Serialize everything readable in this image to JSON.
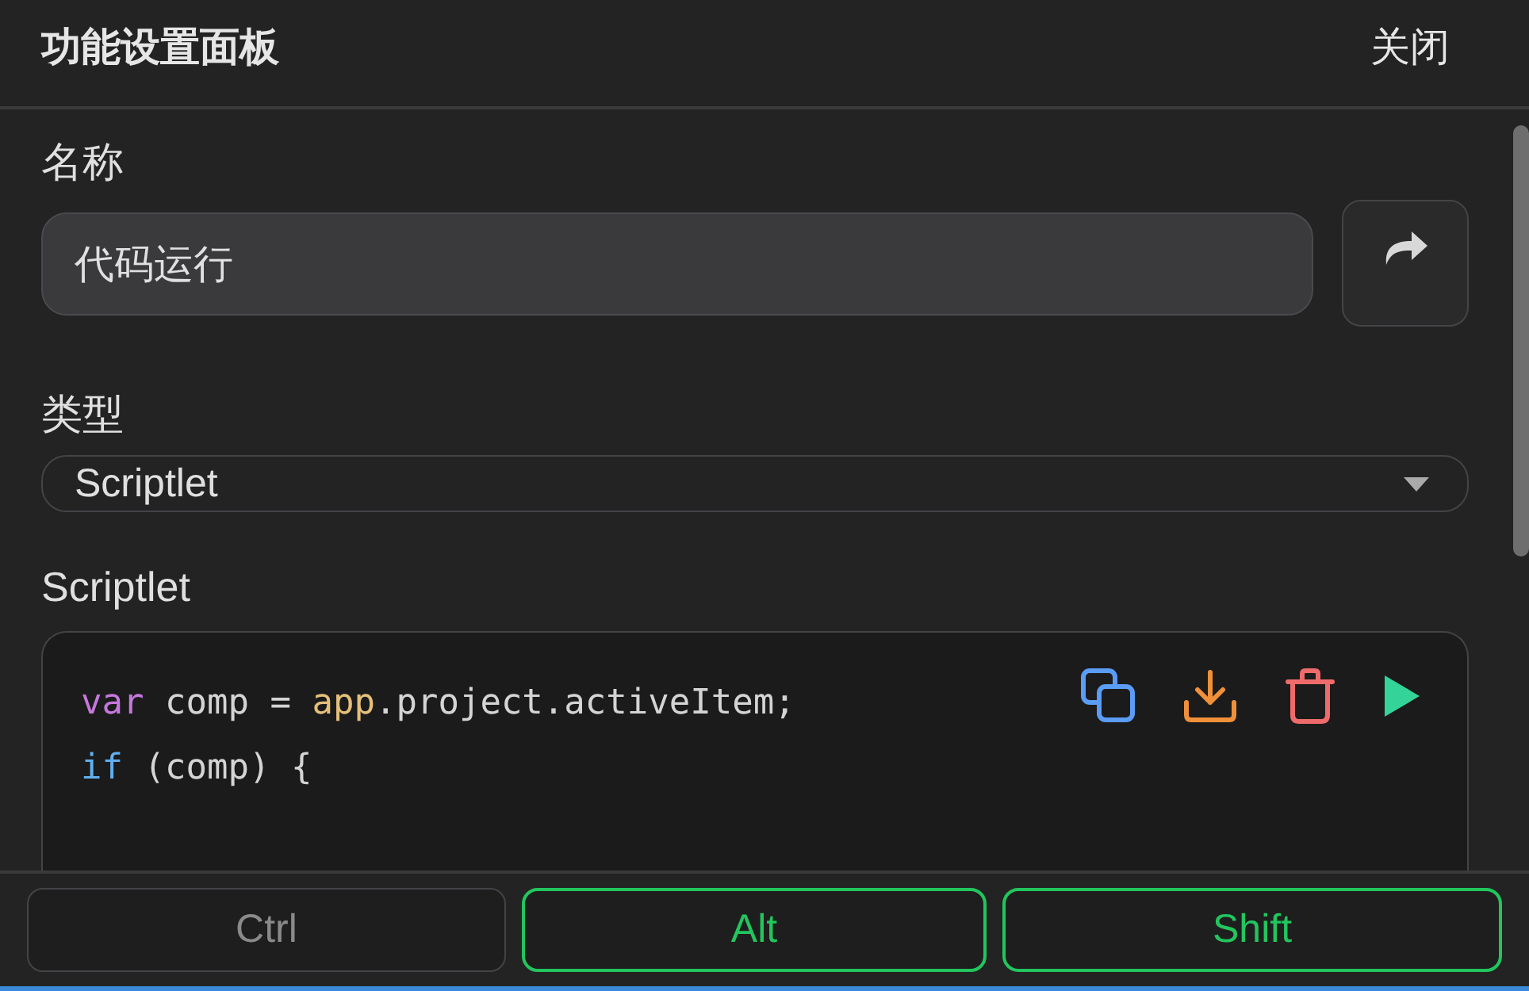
{
  "header": {
    "title": "功能设置面板",
    "close": "关闭"
  },
  "name_field": {
    "label": "名称",
    "value": "代码运行"
  },
  "type_field": {
    "label": "类型",
    "value": "Scriptlet"
  },
  "script": {
    "label": "Scriptlet",
    "lines": [
      [
        {
          "kind": "keyword",
          "text": "var"
        },
        {
          "kind": "plain",
          "text": " comp = "
        },
        {
          "kind": "global",
          "text": "app"
        },
        {
          "kind": "plain",
          "text": ".project.activeItem;"
        }
      ],
      [
        {
          "kind": "control",
          "text": "if"
        },
        {
          "kind": "plain",
          "text": " (comp) {"
        }
      ]
    ]
  },
  "modifier_keys": [
    {
      "label": "Ctrl",
      "selected": false
    },
    {
      "label": "Alt",
      "selected": true
    },
    {
      "label": "Shift",
      "selected": true
    }
  ]
}
